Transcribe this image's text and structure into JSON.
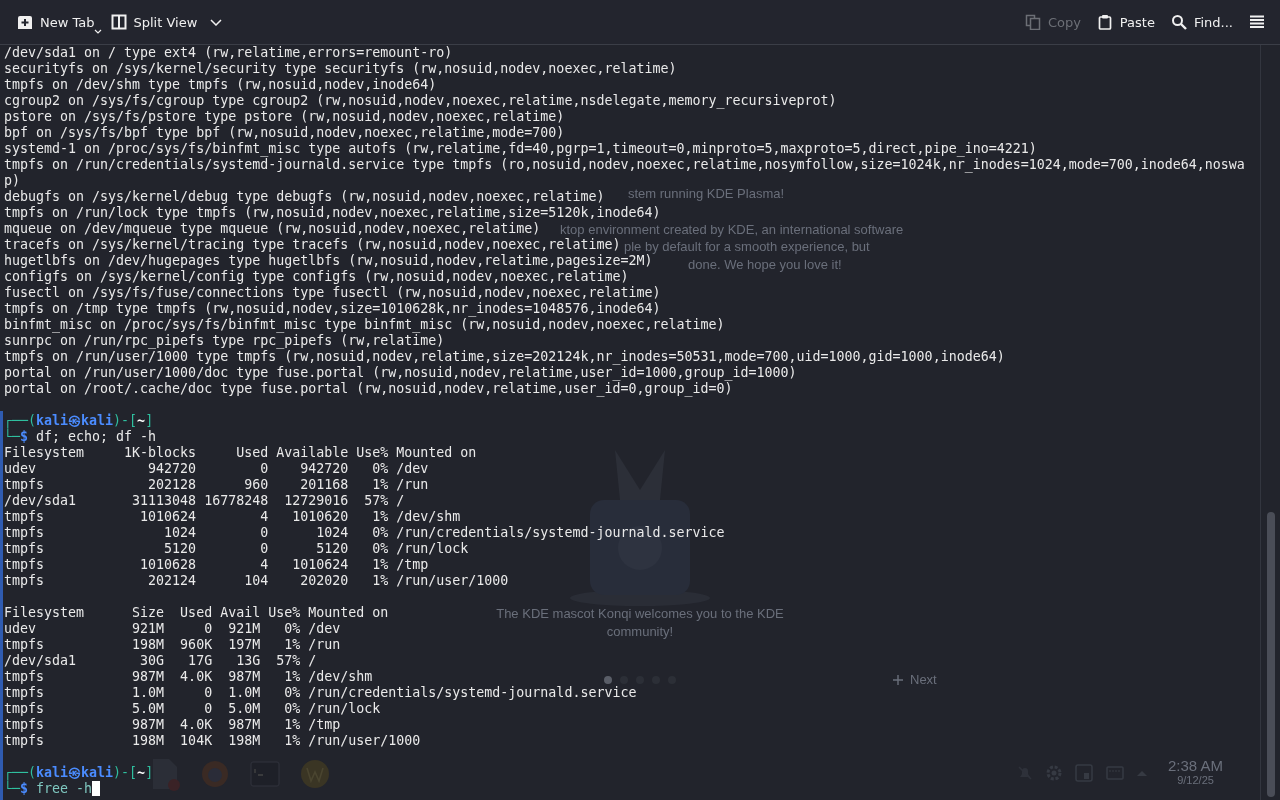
{
  "toolbar": {
    "left": [
      {
        "label": "New Tab",
        "kind": "new-tab",
        "menu": true
      },
      {
        "label": "Split View",
        "kind": "split",
        "menu": true
      }
    ],
    "right": [
      {
        "label": "Copy",
        "kind": "copy",
        "disabled": true
      },
      {
        "label": "Paste",
        "kind": "paste",
        "disabled": false
      },
      {
        "label": "Find...",
        "kind": "find",
        "disabled": false
      },
      {
        "kind": "menu",
        "disabled": false
      }
    ]
  },
  "desktop": {
    "welcome_lines": [
      "stem running KDE Plasma!",
      "ktop environment created by KDE, an international software",
      "ple by default for a smooth experience, but",
      "done. We hope you love it!"
    ],
    "caption": "The KDE mascot Konqi welcomes you to the KDE community!",
    "pager": [
      {
        "selected": true
      },
      {
        "selected": false
      },
      {
        "selected": false
      },
      {
        "selected": false
      },
      {
        "selected": false
      }
    ],
    "next": "Next",
    "clock": {
      "time": "2:38 AM",
      "date": "9/12/25"
    }
  },
  "terminal": {
    "lines": [
      {
        "kind": "output",
        "text": "/dev/sda1 on / type ext4 (rw,relatime,errors=remount-ro)"
      },
      {
        "kind": "output",
        "text": "securityfs on /sys/kernel/security type securityfs (rw,nosuid,nodev,noexec,relatime)"
      },
      {
        "kind": "output",
        "text": "tmpfs on /dev/shm type tmpfs (rw,nosuid,nodev,inode64)"
      },
      {
        "kind": "output",
        "text": "cgroup2 on /sys/fs/cgroup type cgroup2 (rw,nosuid,nodev,noexec,relatime,nsdelegate,memory_recursiveprot)"
      },
      {
        "kind": "output",
        "text": "pstore on /sys/fs/pstore type pstore (rw,nosuid,nodev,noexec,relatime)"
      },
      {
        "kind": "output",
        "text": "bpf on /sys/fs/bpf type bpf (rw,nosuid,nodev,noexec,relatime,mode=700)"
      },
      {
        "kind": "output",
        "text": "systemd-1 on /proc/sys/fs/binfmt_misc type autofs (rw,relatime,fd=40,pgrp=1,timeout=0,minproto=5,maxproto=5,direct,pipe_ino=4221)"
      },
      {
        "kind": "output",
        "text": "tmpfs on /run/credentials/systemd-journald.service type tmpfs (ro,nosuid,nodev,noexec,relatime,nosymfollow,size=1024k,nr_inodes=1024,mode=700,inode64,noswap)"
      },
      {
        "kind": "output",
        "text": "debugfs on /sys/kernel/debug type debugfs (rw,nosuid,nodev,noexec,relatime)"
      },
      {
        "kind": "output",
        "text": "tmpfs on /run/lock type tmpfs (rw,nosuid,nodev,noexec,relatime,size=5120k,inode64)"
      },
      {
        "kind": "output",
        "text": "mqueue on /dev/mqueue type mqueue (rw,nosuid,nodev,noexec,relatime)"
      },
      {
        "kind": "output",
        "text": "tracefs on /sys/kernel/tracing type tracefs (rw,nosuid,nodev,noexec,relatime)"
      },
      {
        "kind": "output",
        "text": "hugetlbfs on /dev/hugepages type hugetlbfs (rw,nosuid,nodev,relatime,pagesize=2M)"
      },
      {
        "kind": "output",
        "text": "configfs on /sys/kernel/config type configfs (rw,nosuid,nodev,noexec,relatime)"
      },
      {
        "kind": "output",
        "text": "fusectl on /sys/fs/fuse/connections type fusectl (rw,nosuid,nodev,noexec,relatime)"
      },
      {
        "kind": "output",
        "text": "tmpfs on /tmp type tmpfs (rw,nosuid,nodev,size=1010628k,nr_inodes=1048576,inode64)"
      },
      {
        "kind": "output",
        "text": "binfmt_misc on /proc/sys/fs/binfmt_misc type binfmt_misc (rw,nosuid,nodev,noexec,relatime)"
      },
      {
        "kind": "output",
        "text": "sunrpc on /run/rpc_pipefs type rpc_pipefs (rw,relatime)"
      },
      {
        "kind": "output",
        "text": "tmpfs on /run/user/1000 type tmpfs (rw,nosuid,nodev,relatime,size=202124k,nr_inodes=50531,mode=700,uid=1000,gid=1000,inode64)"
      },
      {
        "kind": "output",
        "text": "portal on /run/user/1000/doc type fuse.portal (rw,nosuid,nodev,relatime,user_id=1000,group_id=1000)"
      },
      {
        "kind": "output",
        "text": "portal on /root/.cache/doc type fuse.portal (rw,nosuid,nodev,relatime,user_id=0,group_id=0)"
      },
      {
        "kind": "blank"
      },
      {
        "kind": "prompt",
        "open": "┌──(",
        "user": "kali",
        "at": "㉿",
        "host": "kali",
        "mid": ")-[",
        "dir": "~",
        "close": "]",
        "lead": "└─",
        "sign": "$",
        "command": "df; echo; df -h",
        "suggested": false,
        "cursor": false
      },
      {
        "kind": "output",
        "text": "Filesystem     1K-blocks     Used Available Use% Mounted on"
      },
      {
        "kind": "output",
        "text": "udev              942720        0    942720   0% /dev"
      },
      {
        "kind": "output",
        "text": "tmpfs             202128      960    201168   1% /run"
      },
      {
        "kind": "output",
        "text": "/dev/sda1       31113048 16778248  12729016  57% /"
      },
      {
        "kind": "output",
        "text": "tmpfs            1010624        4   1010620   1% /dev/shm"
      },
      {
        "kind": "output",
        "text": "tmpfs               1024        0      1024   0% /run/credentials/systemd-journald.service"
      },
      {
        "kind": "output",
        "text": "tmpfs               5120        0      5120   0% /run/lock"
      },
      {
        "kind": "output",
        "text": "tmpfs            1010628        4   1010624   1% /tmp"
      },
      {
        "kind": "output",
        "text": "tmpfs             202124      104    202020   1% /run/user/1000"
      },
      {
        "kind": "blank"
      },
      {
        "kind": "output",
        "text": "Filesystem      Size  Used Avail Use% Mounted on"
      },
      {
        "kind": "output",
        "text": "udev            921M     0  921M   0% /dev"
      },
      {
        "kind": "output",
        "text": "tmpfs           198M  960K  197M   1% /run"
      },
      {
        "kind": "output",
        "text": "/dev/sda1        30G   17G   13G  57% /"
      },
      {
        "kind": "output",
        "text": "tmpfs           987M  4.0K  987M   1% /dev/shm"
      },
      {
        "kind": "output",
        "text": "tmpfs           1.0M     0  1.0M   0% /run/credentials/systemd-journald.service"
      },
      {
        "kind": "output",
        "text": "tmpfs           5.0M     0  5.0M   0% /run/lock"
      },
      {
        "kind": "output",
        "text": "tmpfs           987M  4.0K  987M   1% /tmp"
      },
      {
        "kind": "output",
        "text": "tmpfs           198M  104K  198M   1% /run/user/1000"
      },
      {
        "kind": "blank"
      },
      {
        "kind": "prompt",
        "open": "┌──(",
        "user": "kali",
        "at": "㉿",
        "host": "kali",
        "mid": ")-[",
        "dir": "~",
        "close": "]",
        "lead": "└─",
        "sign": "$",
        "command": "free -h",
        "suggested": true,
        "cursor": true
      }
    ]
  }
}
